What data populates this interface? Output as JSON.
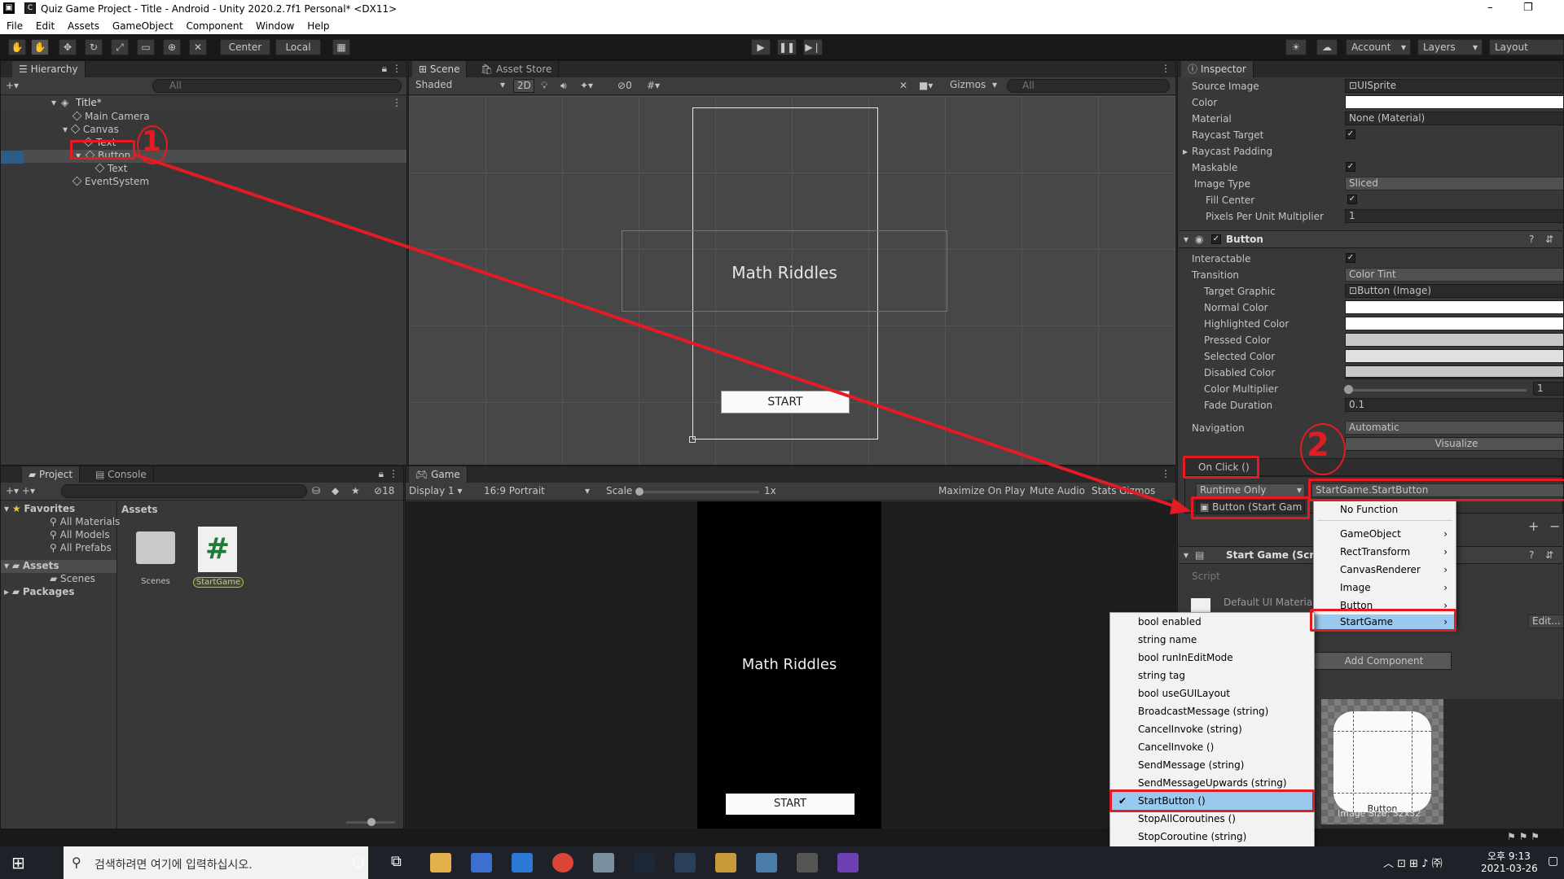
{
  "window": {
    "title": "Quiz Game Project - Title - Android - Unity 2020.2.7f1 Personal* <DX11>",
    "logo": "C",
    "minimize": "–",
    "maximize": "❐"
  },
  "menu": [
    "File",
    "Edit",
    "Assets",
    "GameObject",
    "Component",
    "Window",
    "Help"
  ],
  "toolbar": {
    "center": "Center",
    "local": "Local",
    "account": "Account",
    "layers": "Layers",
    "layout": "Layout"
  },
  "hierarchy": {
    "tab": "Hierarchy",
    "search": "All",
    "scene": "Title*",
    "items": [
      "Main Camera",
      "Canvas",
      "Text",
      "Button",
      "Text",
      "EventSystem"
    ],
    "annotation": "1"
  },
  "scene": {
    "tab": "Scene",
    "tab2": "Asset Store",
    "shading": "Shaded",
    "mode2d": "2D",
    "hidden_count": "0",
    "gizmos": "Gizmos",
    "search": "All",
    "title_text": "Math Riddles",
    "button_text": "START"
  },
  "game": {
    "tab": "Game",
    "display": "Display 1",
    "aspect": "16:9 Portrait",
    "scale_label": "Scale",
    "scale_value": "1x",
    "maximize": "Maximize On Play",
    "mute": "Mute Audio",
    "stats": "Stats",
    "gizmos": "Gizmos",
    "title_text": "Math Riddles",
    "button_text": "START"
  },
  "project": {
    "tab": "Project",
    "tab2": "Console",
    "hidden_count": "18",
    "favorites": "Favorites",
    "fav_items": [
      "All Materials",
      "All Models",
      "All Prefabs"
    ],
    "assets": "Assets",
    "scenes": "Scenes",
    "packages": "Packages",
    "assets_header": "Assets",
    "icons": [
      {
        "label": "Scenes"
      },
      {
        "label": "StartGame"
      }
    ]
  },
  "inspector": {
    "tab": "Inspector",
    "image_rows": [
      {
        "label": "Source Image",
        "value": "UISprite"
      },
      {
        "label": "Color",
        "value": ""
      },
      {
        "label": "Material",
        "value": "None (Material)"
      },
      {
        "label": "Raycast Target",
        "value": "✓"
      },
      {
        "label": "Raycast Padding",
        "value": ""
      },
      {
        "label": "Maskable",
        "value": "✓"
      },
      {
        "label": "Image Type",
        "value": "Sliced"
      },
      {
        "label": "Fill Center",
        "value": "✓"
      },
      {
        "label": "Pixels Per Unit Multiplier",
        "value": "1"
      }
    ],
    "button_header": "Button",
    "button_rows": [
      {
        "label": "Interactable",
        "value": "✓"
      },
      {
        "label": "Transition",
        "value": "Color Tint"
      },
      {
        "label": "Target Graphic",
        "value": "Button (Image)"
      },
      {
        "label": "Normal Color",
        "value": ""
      },
      {
        "label": "Highlighted Color",
        "value": ""
      },
      {
        "label": "Pressed Color",
        "value": ""
      },
      {
        "label": "Selected Color",
        "value": ""
      },
      {
        "label": "Disabled Color",
        "value": ""
      },
      {
        "label": "Color Multiplier",
        "value": "1"
      },
      {
        "label": "Fade Duration",
        "value": "0.1"
      }
    ],
    "navigation": "Navigation",
    "navigation_value": "Automatic",
    "visualize": "Visualize",
    "onclick": "On Click ()",
    "runtime": "Runtime Only",
    "function": "StartGame.StartButton",
    "object": "Button (Start Gam",
    "script_header": "Start Game (Scrip",
    "script_label": "Script",
    "material": "Default UI Materia",
    "add_component": "Add Component",
    "edit": "Edit...",
    "preview_label": "Button",
    "preview_size": "Image Size: 32x32",
    "annotation": "2"
  },
  "function_menu": [
    {
      "label": "No Function",
      "sub": false
    },
    {
      "label": "GameObject",
      "sub": true
    },
    {
      "label": "RectTransform",
      "sub": true
    },
    {
      "label": "CanvasRenderer",
      "sub": true
    },
    {
      "label": "Image",
      "sub": true
    },
    {
      "label": "Button",
      "sub": true
    },
    {
      "label": "StartGame",
      "sub": true
    }
  ],
  "method_menu": [
    "bool enabled",
    "string name",
    "bool runInEditMode",
    "string tag",
    "bool useGUILayout",
    "BroadcastMessage (string)",
    "CancelInvoke (string)",
    "CancelInvoke ()",
    "SendMessage (string)",
    "SendMessageUpwards (string)",
    "StartButton ()",
    "StopAllCoroutines ()",
    "StopCoroutine (string)"
  ],
  "taskbar": {
    "search": "검색하려면 여기에 입력하십시오.",
    "time": "오후 9:13",
    "date": "2021-03-26"
  },
  "colors": {
    "annotation": "#e41b23",
    "selection": "#99c9ef"
  }
}
